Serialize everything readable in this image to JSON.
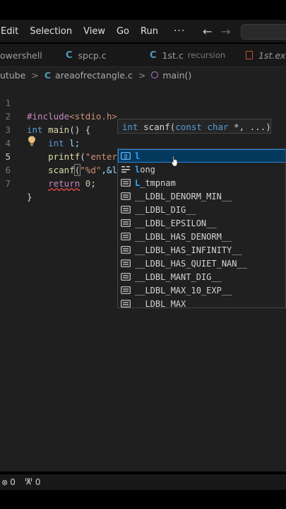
{
  "menu": {
    "items": [
      "Edit",
      "Selection",
      "View",
      "Go",
      "Run"
    ],
    "more": "···",
    "back_icon": "←",
    "forward_icon": "→"
  },
  "tabs": [
    {
      "label": "owershell",
      "icon": "none"
    },
    {
      "label": "spcp.c",
      "icon": "c-file-icon"
    },
    {
      "label": "1st.c",
      "description": "recursion",
      "icon": "c-file-icon"
    },
    {
      "label": "1st.exe",
      "icon": "binary-file-icon"
    }
  ],
  "breadcrumb": {
    "folder": "utube",
    "file": "areaofrectangle.c",
    "symbol": "main()",
    "separator": ">"
  },
  "editor": {
    "line_numbers": [
      "1",
      "2",
      "3",
      "4",
      "5",
      "6",
      "7"
    ],
    "active_line": 5,
    "lines": {
      "l1": {
        "directive": "#include",
        "header": "<stdio.h>"
      },
      "l2": {
        "type": "int",
        "name": "main",
        "rest": "() {"
      },
      "l3": {
        "type": "int",
        "rest": " l;"
      },
      "l4": {
        "fn": "printf",
        "open": "(",
        "str": "\"enter"
      },
      "l5": {
        "fn": "scanf",
        "open": "(",
        "str": "\"%d\"",
        "rest": ",&l",
        "close": ")"
      },
      "l6": {
        "kw": "return",
        "num": "0",
        "end": ";"
      },
      "l7": {
        "brace": "}"
      }
    }
  },
  "signature_help": {
    "ret": "int",
    "fn": "scanf",
    "open": "(",
    "param_kw": "const char",
    "param_rest": " *, ...)"
  },
  "suggestions": [
    {
      "icon": "variable-icon",
      "label_match": "l",
      "label_rest": "",
      "selected": true
    },
    {
      "icon": "keyword-icon",
      "label_match": "l",
      "label_rest": "ong",
      "selected": false
    },
    {
      "icon": "text-icon",
      "label_match": "L",
      "label_rest": "_tmpnam",
      "selected": false
    },
    {
      "icon": "text-icon",
      "label_match": "",
      "label_rest": "__LDBL_DENORM_MIN__",
      "selected": false
    },
    {
      "icon": "text-icon",
      "label_match": "",
      "label_rest": "__LDBL_DIG__",
      "selected": false
    },
    {
      "icon": "text-icon",
      "label_match": "",
      "label_rest": "__LDBL_EPSILON__",
      "selected": false
    },
    {
      "icon": "text-icon",
      "label_match": "",
      "label_rest": "__LDBL_HAS_DENORM__",
      "selected": false
    },
    {
      "icon": "text-icon",
      "label_match": "",
      "label_rest": "__LDBL_HAS_INFINITY__",
      "selected": false
    },
    {
      "icon": "text-icon",
      "label_match": "",
      "label_rest": "__LDBL_HAS_QUIET_NAN__",
      "selected": false
    },
    {
      "icon": "text-icon",
      "label_match": "",
      "label_rest": "__LDBL_MANT_DIG__",
      "selected": false
    },
    {
      "icon": "text-icon",
      "label_match": "",
      "label_rest": "__LDBL_MAX_10_EXP__",
      "selected": false
    },
    {
      "icon": "text-icon",
      "label_match": "",
      "label_rest": "__LDBL_MAX__",
      "selected": false
    }
  ],
  "status": {
    "errors": "0",
    "warnings": "0"
  },
  "colors": {
    "accent": "#2488db",
    "selection_bg": "#04395e",
    "editor_bg": "#1f1f1f",
    "keyword": "#569cd6",
    "function": "#dcdcaa",
    "string": "#ce9178"
  }
}
